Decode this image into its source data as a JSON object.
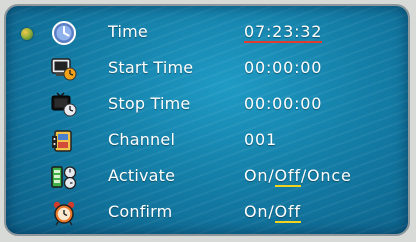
{
  "rows": [
    {
      "label": "Time",
      "value": "07:23:32",
      "icon": "clock-icon"
    },
    {
      "label": "Start Time",
      "value": "00:00:00",
      "icon": "tv-clock-start-icon"
    },
    {
      "label": "Stop Time",
      "value": "00:00:00",
      "icon": "tv-clock-stop-icon"
    },
    {
      "label": "Channel",
      "value": "001",
      "icon": "channel-film-icon"
    },
    {
      "label": "Activate",
      "options": [
        "On",
        "Off",
        "Once"
      ],
      "selected": "Off",
      "icon": "activate-icon"
    },
    {
      "label": "Confirm",
      "options": [
        "On",
        "Off"
      ],
      "selected": "Off",
      "icon": "alarm-clock-icon"
    }
  ],
  "separator": "/",
  "colors": {
    "background": "#147fa8",
    "text": "#ffffff",
    "focus_underline": "#e33b2e",
    "selected_underline": "#f1d21c"
  }
}
